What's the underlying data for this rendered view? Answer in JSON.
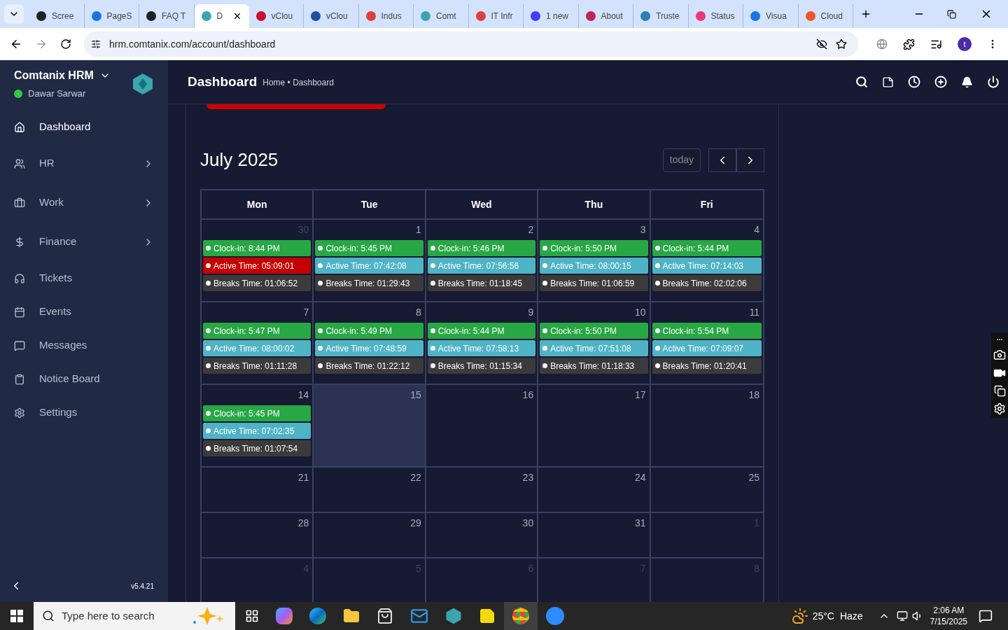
{
  "browser": {
    "tabs": [
      {
        "title": "Scree",
        "color": "#202124",
        "selected": false
      },
      {
        "title": "PageS",
        "color": "#1a73e8",
        "selected": false
      },
      {
        "title": "FAQ T",
        "color": "#202124",
        "selected": false
      },
      {
        "title": "D",
        "color": "#3aa6b0",
        "selected": true
      },
      {
        "title": "vClou",
        "color": "#c8102e",
        "selected": false
      },
      {
        "title": "vClou",
        "color": "#1d4fa5",
        "selected": false
      },
      {
        "title": "Indus",
        "color": "#e0403a",
        "selected": false
      },
      {
        "title": "Comt",
        "color": "#3aa6b0",
        "selected": false
      },
      {
        "title": "IT Infr",
        "color": "#e0403a",
        "selected": false
      },
      {
        "title": "1 new",
        "color": "#4a3aff",
        "selected": false
      },
      {
        "title": "About",
        "color": "#c0264f",
        "selected": false
      },
      {
        "title": "Truste",
        "color": "#2a7fb8",
        "selected": false
      },
      {
        "title": "Status",
        "color": "#e8397a",
        "selected": false
      },
      {
        "title": "Visua",
        "color": "#1a73e8",
        "selected": false
      },
      {
        "title": "Cloud",
        "color": "#f0552a",
        "selected": false
      }
    ],
    "url": "hrm.comtanix.com/account/dashboard",
    "profile": "t"
  },
  "sidebar": {
    "brand": "Comtanix HRM",
    "user": "Dawar Sarwar",
    "online": true,
    "version": "v5.4.21",
    "items": [
      {
        "label": "Dashboard",
        "selected": true,
        "expandable": false
      },
      {
        "label": "HR",
        "selected": false,
        "expandable": true
      },
      {
        "label": "Work",
        "selected": false,
        "expandable": true
      },
      {
        "label": "Finance",
        "selected": false,
        "expandable": true
      },
      {
        "label": "Tickets",
        "selected": false,
        "expandable": false
      },
      {
        "label": "Events",
        "selected": false,
        "expandable": false
      },
      {
        "label": "Messages",
        "selected": false,
        "expandable": false
      },
      {
        "label": "Notice Board",
        "selected": false,
        "expandable": false
      },
      {
        "label": "Settings",
        "selected": false,
        "expandable": false
      }
    ]
  },
  "header": {
    "title": "Dashboard",
    "breadcrumb": "Home • Dashboard"
  },
  "calendar": {
    "title": "July 2025",
    "today_button": "today",
    "weekdays": [
      "Mon",
      "Tue",
      "Wed",
      "Thu",
      "Fri"
    ],
    "weeks": [
      {
        "days": [
          {
            "day": "30",
            "muted": true,
            "today": false,
            "events": [
              {
                "text": "Clock-in: 8:44 PM",
                "color": "#28a745"
              },
              {
                "text": "Active Time: 05:09:01",
                "color": "#c40000"
              },
              {
                "text": "Breaks Time: 01:06:52",
                "color": "#3b3b3b"
              }
            ]
          },
          {
            "day": "1",
            "muted": false,
            "today": false,
            "events": [
              {
                "text": "Clock-in: 5:45 PM",
                "color": "#28a745"
              },
              {
                "text": "Active Time: 07:42:08",
                "color": "#4fb3c6"
              },
              {
                "text": "Breaks Time: 01:29:43",
                "color": "#3b3b3b"
              }
            ]
          },
          {
            "day": "2",
            "muted": false,
            "today": false,
            "events": [
              {
                "text": "Clock-in: 5:46 PM",
                "color": "#28a745"
              },
              {
                "text": "Active Time: 07:56:56",
                "color": "#4fb3c6"
              },
              {
                "text": "Breaks Time: 01:18:45",
                "color": "#3b3b3b"
              }
            ]
          },
          {
            "day": "3",
            "muted": false,
            "today": false,
            "events": [
              {
                "text": "Clock-in: 5:50 PM",
                "color": "#28a745"
              },
              {
                "text": "Active Time: 08:00:15",
                "color": "#4fb3c6"
              },
              {
                "text": "Breaks Time: 01:06:59",
                "color": "#3b3b3b"
              }
            ]
          },
          {
            "day": "4",
            "muted": false,
            "today": false,
            "events": [
              {
                "text": "Clock-in: 5:44 PM",
                "color": "#28a745"
              },
              {
                "text": "Active Time: 07:14:03",
                "color": "#4fb3c6"
              },
              {
                "text": "Breaks Time: 02:02:06",
                "color": "#3b3b3b"
              }
            ]
          }
        ]
      },
      {
        "days": [
          {
            "day": "7",
            "muted": false,
            "today": false,
            "events": [
              {
                "text": "Clock-in: 5:47 PM",
                "color": "#28a745"
              },
              {
                "text": "Active Time: 08:00:02",
                "color": "#4fb3c6"
              },
              {
                "text": "Breaks Time: 01:11:28",
                "color": "#3b3b3b"
              }
            ]
          },
          {
            "day": "8",
            "muted": false,
            "today": false,
            "events": [
              {
                "text": "Clock-in: 5:49 PM",
                "color": "#28a745"
              },
              {
                "text": "Active Time: 07:48:59",
                "color": "#4fb3c6"
              },
              {
                "text": "Breaks Time: 01:22:12",
                "color": "#3b3b3b"
              }
            ]
          },
          {
            "day": "9",
            "muted": false,
            "today": false,
            "events": [
              {
                "text": "Clock-in: 5:44 PM",
                "color": "#28a745"
              },
              {
                "text": "Active Time: 07:58:13",
                "color": "#4fb3c6"
              },
              {
                "text": "Breaks Time: 01:15:34",
                "color": "#3b3b3b"
              }
            ]
          },
          {
            "day": "10",
            "muted": false,
            "today": false,
            "events": [
              {
                "text": "Clock-in: 5:50 PM",
                "color": "#28a745"
              },
              {
                "text": "Active Time: 07:51:08",
                "color": "#4fb3c6"
              },
              {
                "text": "Breaks Time: 01:18:33",
                "color": "#3b3b3b"
              }
            ]
          },
          {
            "day": "11",
            "muted": false,
            "today": false,
            "events": [
              {
                "text": "Clock-in: 5:54 PM",
                "color": "#28a745"
              },
              {
                "text": "Active Time: 07:09:07",
                "color": "#4fb3c6"
              },
              {
                "text": "Breaks Time: 01:20:41",
                "color": "#3b3b3b"
              }
            ]
          }
        ]
      },
      {
        "days": [
          {
            "day": "14",
            "muted": false,
            "today": false,
            "events": [
              {
                "text": "Clock-in: 5:45 PM",
                "color": "#28a745"
              },
              {
                "text": "Active Time: 07:02:35",
                "color": "#4fb3c6"
              },
              {
                "text": "Breaks Time: 01:07:54",
                "color": "#3b3b3b"
              }
            ]
          },
          {
            "day": "15",
            "muted": false,
            "today": true
          },
          {
            "day": "16",
            "muted": false,
            "today": false
          },
          {
            "day": "17",
            "muted": false,
            "today": false
          },
          {
            "day": "18",
            "muted": false,
            "today": false
          }
        ]
      },
      {
        "days": [
          {
            "day": "21",
            "muted": false,
            "today": false
          },
          {
            "day": "22",
            "muted": false,
            "today": false
          },
          {
            "day": "23",
            "muted": false,
            "today": false
          },
          {
            "day": "24",
            "muted": false,
            "today": false
          },
          {
            "day": "25",
            "muted": false,
            "today": false
          }
        ]
      },
      {
        "days": [
          {
            "day": "28",
            "muted": false,
            "today": false
          },
          {
            "day": "29",
            "muted": false,
            "today": false
          },
          {
            "day": "30",
            "muted": false,
            "today": false
          },
          {
            "day": "31",
            "muted": false,
            "today": false
          },
          {
            "day": "1",
            "muted": true,
            "today": false
          }
        ]
      },
      {
        "days": [
          {
            "day": "4",
            "muted": true,
            "today": false
          },
          {
            "day": "5",
            "muted": true,
            "today": false
          },
          {
            "day": "6",
            "muted": true,
            "today": false
          },
          {
            "day": "7",
            "muted": true,
            "today": false
          },
          {
            "day": "8",
            "muted": true,
            "today": false
          }
        ]
      }
    ]
  },
  "taskbar": {
    "search_placeholder": "Type here to search",
    "temperature": "25°C",
    "weather": "Haze",
    "time": "2:06 AM",
    "date": "7/15/2025"
  }
}
